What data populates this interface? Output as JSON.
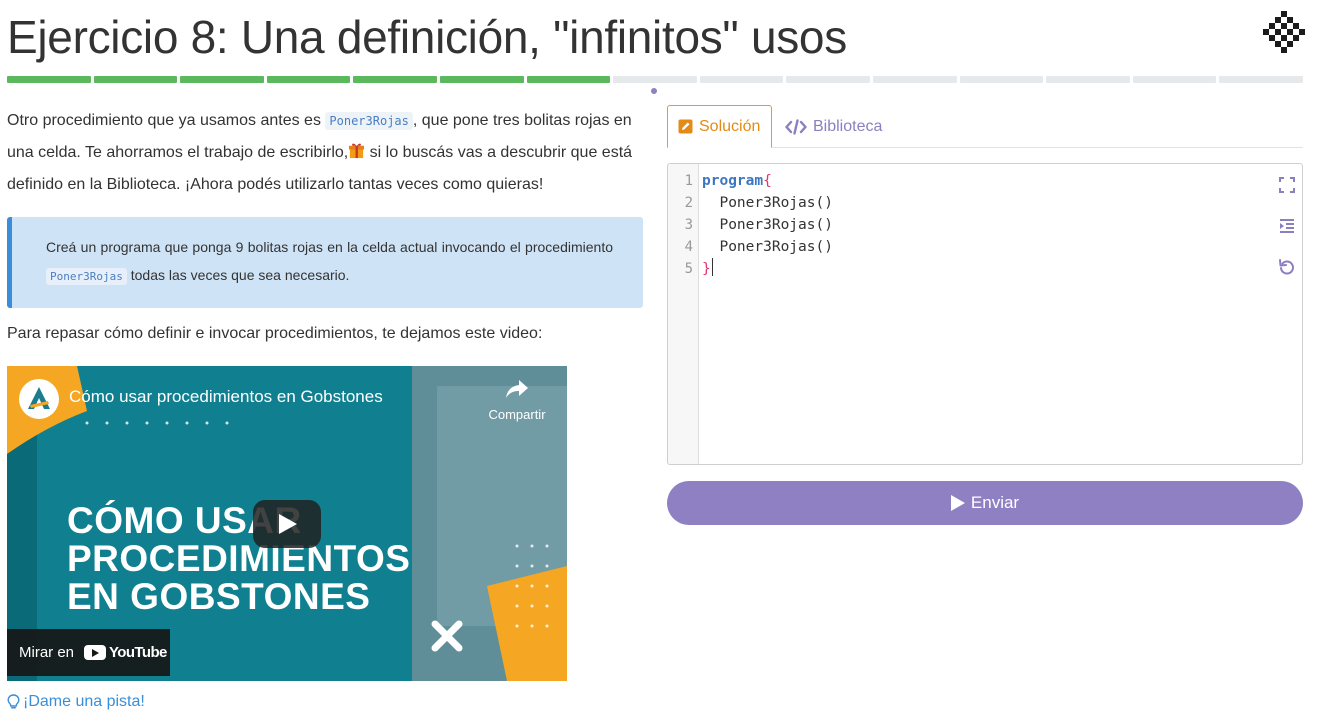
{
  "header": {
    "title": "Ejercicio 8: Una definición, \"infinitos\" usos",
    "progress": {
      "total": 15,
      "completed": 7,
      "done_color": "#5cb85c",
      "pending_color": "#e6e9ec"
    }
  },
  "content": {
    "intro_before_code": "Otro procedimiento que ya usamos antes es ",
    "intro_code": "Poner3Rojas",
    "intro_after_code": ", que pone tres bolitas rojas en una celda. Te ahorramos el trabajo de escribirlo,",
    "intro_after_gift": " si lo buscás vas a descubrir que está definido en la Biblioteca. ¡Ahora podés utilizarlo tantas veces como quieras!",
    "task_before_code": "Creá un programa que ponga 9 bolitas rojas en la celda actual invocando el procedimiento ",
    "task_code": "Poner3Rojas",
    "task_after_code": " todas las veces que sea necesario.",
    "video_intro": "Para repasar cómo definir e invocar procedimientos, te dejamos este video:",
    "hint": "¡Dame una pista!"
  },
  "video": {
    "title": "Cómo usar procedimientos en Gobstones",
    "share_label": "Compartir",
    "big_lines": [
      "CÓMO USAR",
      "PROCEDIMIENTOS",
      "EN GOBSTONES"
    ],
    "watch_label": "Mirar en",
    "youtube_label": "YouTube"
  },
  "tabs": {
    "solution": "Solución",
    "library": "Biblioteca"
  },
  "editor": {
    "line_numbers": [
      "1",
      "2",
      "3",
      "4",
      "5"
    ],
    "keyword": "program",
    "open_brace": "{",
    "lines": [
      "  Poner3Rojas()",
      "  Poner3Rojas()",
      "  Poner3Rojas()"
    ],
    "close_brace": "}",
    "tools": [
      "fullscreen-icon",
      "indent-icon",
      "reset-icon"
    ]
  },
  "submit": {
    "label": "Enviar",
    "color": "#8e80c2"
  },
  "colors": {
    "accent_orange": "#e28b17",
    "accent_purple": "#8e80c2",
    "link_blue": "#3a8ed8",
    "callout_bg": "#cfe3f6"
  }
}
